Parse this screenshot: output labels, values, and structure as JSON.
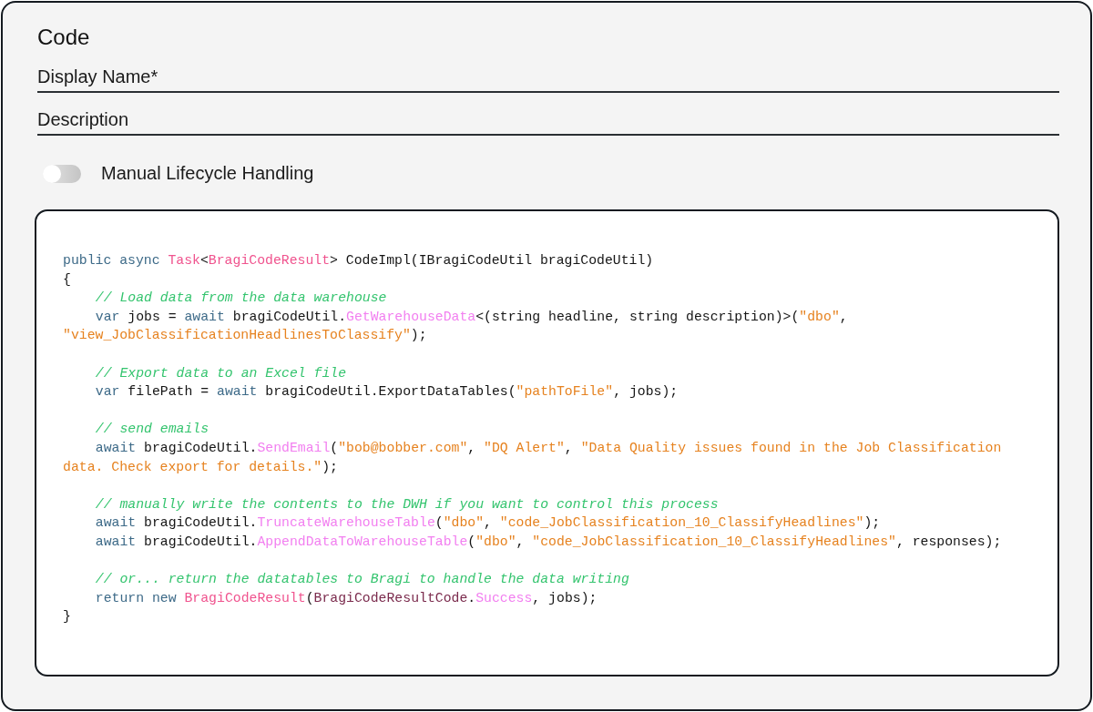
{
  "title": "Code",
  "fields": [
    {
      "placeholder": "Display Name*"
    },
    {
      "placeholder": "Description"
    }
  ],
  "toggle": {
    "label": "Manual Lifecycle Handling",
    "on": false
  },
  "code_lines": [
    {
      "kind": "code",
      "indented": false,
      "tokens": [
        {
          "kind": "keyword",
          "text": "public async "
        },
        {
          "kind": "type",
          "text": "Task"
        },
        {
          "kind": "plain",
          "text": "<"
        },
        {
          "kind": "type",
          "text": "BragiCodeResult"
        },
        {
          "kind": "plain",
          "text": "> CodeImpl(IBragiCodeUtil bragiCodeUtil)"
        }
      ]
    },
    {
      "kind": "code",
      "indented": false,
      "tokens": [
        {
          "kind": "plain",
          "text": "{"
        }
      ]
    },
    {
      "kind": "code",
      "indented": true,
      "tokens": [
        {
          "kind": "comment",
          "text": "// Load data from the data warehouse"
        }
      ]
    },
    {
      "kind": "code",
      "indented": true,
      "tokens": [
        {
          "kind": "keyword",
          "text": "var"
        },
        {
          "kind": "plain",
          "text": " jobs = "
        },
        {
          "kind": "keyword",
          "text": "await"
        },
        {
          "kind": "plain",
          "text": " bragiCodeUtil."
        },
        {
          "kind": "method",
          "text": "GetWarehouseData"
        },
        {
          "kind": "plain",
          "text": "<(string headline, string description)>("
        },
        {
          "kind": "string",
          "text": "\"dbo\""
        },
        {
          "kind": "plain",
          "text": ","
        }
      ]
    },
    {
      "kind": "code",
      "indented": false,
      "tokens": [
        {
          "kind": "string",
          "text": "\"view_JobClassificationHeadlinesToClassify\""
        },
        {
          "kind": "plain",
          "text": ");"
        }
      ]
    },
    {
      "kind": "blank"
    },
    {
      "kind": "code",
      "indented": true,
      "tokens": [
        {
          "kind": "comment",
          "text": "// Export data to an Excel file"
        }
      ]
    },
    {
      "kind": "code",
      "indented": true,
      "tokens": [
        {
          "kind": "keyword",
          "text": "var"
        },
        {
          "kind": "plain",
          "text": " filePath = "
        },
        {
          "kind": "keyword",
          "text": "await"
        },
        {
          "kind": "plain",
          "text": " bragiCodeUtil.ExportDataTables("
        },
        {
          "kind": "string",
          "text": "\"pathToFile\""
        },
        {
          "kind": "plain",
          "text": ", jobs);"
        }
      ]
    },
    {
      "kind": "blank"
    },
    {
      "kind": "code",
      "indented": true,
      "tokens": [
        {
          "kind": "comment",
          "text": "// send emails"
        }
      ]
    },
    {
      "kind": "code",
      "indented": true,
      "tokens": [
        {
          "kind": "keyword",
          "text": "await"
        },
        {
          "kind": "plain",
          "text": " bragiCodeUtil."
        },
        {
          "kind": "method",
          "text": "SendEmail"
        },
        {
          "kind": "plain",
          "text": "("
        },
        {
          "kind": "string",
          "text": "\"bob@bobber.com\""
        },
        {
          "kind": "plain",
          "text": ", "
        },
        {
          "kind": "string",
          "text": "\"DQ Alert\""
        },
        {
          "kind": "plain",
          "text": ", "
        },
        {
          "kind": "string",
          "text": "\"Data Quality issues found in the Job Classification"
        }
      ]
    },
    {
      "kind": "code",
      "indented": false,
      "tokens": [
        {
          "kind": "string",
          "text": "data. Check export for details.\""
        },
        {
          "kind": "plain",
          "text": ");"
        }
      ]
    },
    {
      "kind": "blank"
    },
    {
      "kind": "code",
      "indented": true,
      "tokens": [
        {
          "kind": "comment",
          "text": "// manually write the contents to the DWH if you want to control this process"
        }
      ]
    },
    {
      "kind": "code",
      "indented": true,
      "tokens": [
        {
          "kind": "keyword",
          "text": "await"
        },
        {
          "kind": "plain",
          "text": " bragiCodeUtil."
        },
        {
          "kind": "method",
          "text": "TruncateWarehouseTable"
        },
        {
          "kind": "plain",
          "text": "("
        },
        {
          "kind": "string",
          "text": "\"dbo\""
        },
        {
          "kind": "plain",
          "text": ", "
        },
        {
          "kind": "string",
          "text": "\"code_JobClassification_10_ClassifyHeadlines\""
        },
        {
          "kind": "plain",
          "text": ");"
        }
      ]
    },
    {
      "kind": "code",
      "indented": true,
      "tokens": [
        {
          "kind": "keyword",
          "text": "await"
        },
        {
          "kind": "plain",
          "text": " bragiCodeUtil."
        },
        {
          "kind": "method",
          "text": "AppendDataToWarehouseTable"
        },
        {
          "kind": "plain",
          "text": "("
        },
        {
          "kind": "string",
          "text": "\"dbo\""
        },
        {
          "kind": "plain",
          "text": ", "
        },
        {
          "kind": "string",
          "text": "\"code_JobClassification_10_ClassifyHeadlines\""
        },
        {
          "kind": "plain",
          "text": ", responses);"
        }
      ]
    },
    {
      "kind": "blank"
    },
    {
      "kind": "code",
      "indented": true,
      "tokens": [
        {
          "kind": "comment",
          "text": "// or... return the datatables to Bragi to handle the data writing"
        }
      ]
    },
    {
      "kind": "code",
      "indented": true,
      "tokens": [
        {
          "kind": "keyword",
          "text": "return new "
        },
        {
          "kind": "type",
          "text": "BragiCodeResult"
        },
        {
          "kind": "plain",
          "text": "("
        },
        {
          "kind": "enum",
          "text": "BragiCodeResultCode"
        },
        {
          "kind": "plain",
          "text": "."
        },
        {
          "kind": "method",
          "text": "Success"
        },
        {
          "kind": "plain",
          "text": ", jobs);"
        }
      ]
    },
    {
      "kind": "code",
      "indented": false,
      "tokens": [
        {
          "kind": "plain",
          "text": "}"
        }
      ]
    }
  ]
}
